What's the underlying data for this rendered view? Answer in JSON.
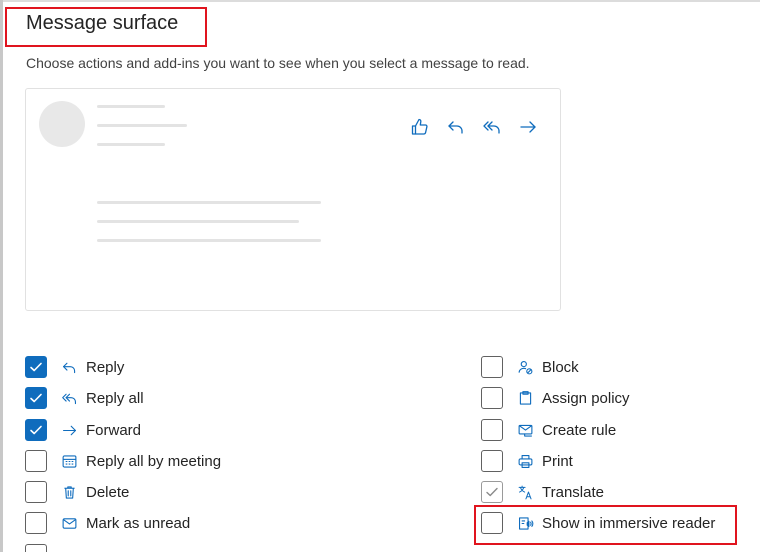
{
  "section": {
    "title": "Message surface",
    "subtitle": "Choose actions and add-ins you want to see when you select a message to read."
  },
  "preview": {
    "toolbar_icons": [
      "like-icon",
      "reply-icon",
      "reply-all-icon",
      "forward-icon"
    ]
  },
  "options_left": [
    {
      "label": "Reply",
      "icon": "reply-icon",
      "checked": true
    },
    {
      "label": "Reply all",
      "icon": "reply-all-icon",
      "checked": true
    },
    {
      "label": "Forward",
      "icon": "forward-icon",
      "checked": true
    },
    {
      "label": "Reply all by meeting",
      "icon": "calendar-icon",
      "checked": false
    },
    {
      "label": "Delete",
      "icon": "trash-icon",
      "checked": false
    },
    {
      "label": "Mark as unread",
      "icon": "envelope-icon",
      "checked": false
    }
  ],
  "options_right": [
    {
      "label": "Block",
      "icon": "block-person-icon",
      "checked": false
    },
    {
      "label": "Assign policy",
      "icon": "policy-icon",
      "checked": false
    },
    {
      "label": "Create rule",
      "icon": "rule-icon",
      "checked": false
    },
    {
      "label": "Print",
      "icon": "printer-icon",
      "checked": false
    },
    {
      "label": "Translate",
      "icon": "translate-icon",
      "checked": true,
      "disabled": true
    },
    {
      "label": "Show in immersive reader",
      "icon": "immersive-reader-icon",
      "checked": false
    }
  ],
  "colors": {
    "accent": "#0f6cbd",
    "highlight": "#e0141e"
  }
}
